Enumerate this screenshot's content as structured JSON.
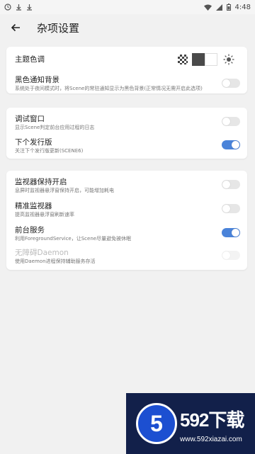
{
  "status_bar": {
    "time": "4:48"
  },
  "app_bar": {
    "title": "杂项设置"
  },
  "theme": {
    "label": "主题色调"
  },
  "settings": {
    "black_notification": {
      "title": "黑色通知背景",
      "desc": "系统处于夜间模式时，将Scene的常驻通知显示为黑色背景(正常情况无需开启此选项)",
      "on": false
    },
    "debug_window": {
      "title": "调试窗口",
      "desc": "显示Scene判定前台应用过程的日志",
      "on": false
    },
    "next_release": {
      "title": "下个发行版",
      "desc": "关注下个发行版更新(SCENE6)",
      "on": true
    },
    "monitor_keep": {
      "title": "监视器保持开启",
      "desc": "息屏时监视器悬浮窗保持开启，可能增加耗电",
      "on": false
    },
    "precise_monitor": {
      "title": "精准监视器",
      "desc": "提高监视器悬浮窗刷新速率",
      "on": false
    },
    "foreground_service": {
      "title": "前台服务",
      "desc": "利用ForegroundService，让Scene尽量避免被休眠",
      "on": true
    },
    "daemon": {
      "title": "无障碍Daemon",
      "desc": "使用Daemon进程保持辅助服务存活",
      "on": false
    }
  },
  "ad": {
    "logo": "5",
    "brand": "592下载",
    "url": "www.592xiazai.com"
  },
  "colors": {
    "accent": "#4a83d9",
    "background": "#f1f1f1"
  }
}
